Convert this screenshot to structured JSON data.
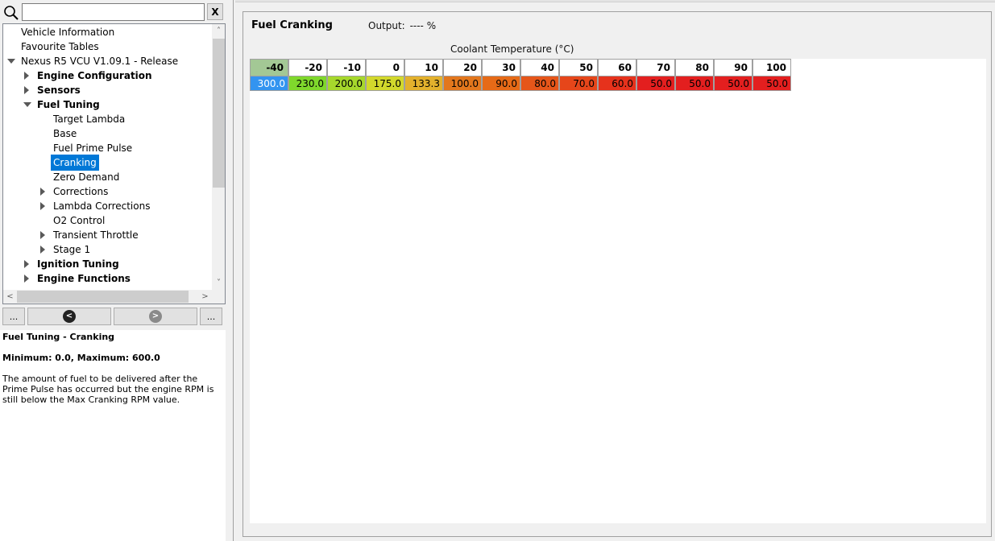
{
  "search": {
    "placeholder": "",
    "value": "",
    "clear_label": "X"
  },
  "tree": {
    "items": [
      {
        "label": "Vehicle Information",
        "level": 0,
        "arrow": "none",
        "bold": false,
        "selected": false
      },
      {
        "label": "Favourite Tables",
        "level": 0,
        "arrow": "none",
        "bold": false,
        "selected": false
      },
      {
        "label": "Nexus R5 VCU V1.09.1 - Release",
        "level": 0,
        "arrow": "down",
        "bold": false,
        "selected": false
      },
      {
        "label": "Engine Configuration",
        "level": 1,
        "arrow": "right",
        "bold": true,
        "selected": false
      },
      {
        "label": "Sensors",
        "level": 1,
        "arrow": "right",
        "bold": true,
        "selected": false
      },
      {
        "label": "Fuel Tuning",
        "level": 1,
        "arrow": "down",
        "bold": true,
        "selected": false
      },
      {
        "label": "Target Lambda",
        "level": 2,
        "arrow": "none",
        "bold": false,
        "selected": false
      },
      {
        "label": "Base",
        "level": 2,
        "arrow": "none",
        "bold": false,
        "selected": false
      },
      {
        "label": "Fuel Prime Pulse",
        "level": 2,
        "arrow": "none",
        "bold": false,
        "selected": false
      },
      {
        "label": "Cranking",
        "level": 2,
        "arrow": "none",
        "bold": false,
        "selected": true
      },
      {
        "label": "Zero Demand",
        "level": 2,
        "arrow": "none",
        "bold": false,
        "selected": false
      },
      {
        "label": "Corrections",
        "level": 2,
        "arrow": "right",
        "bold": false,
        "selected": false
      },
      {
        "label": "Lambda Corrections",
        "level": 2,
        "arrow": "right",
        "bold": false,
        "selected": false
      },
      {
        "label": "O2 Control",
        "level": 2,
        "arrow": "none",
        "bold": false,
        "selected": false
      },
      {
        "label": "Transient Throttle",
        "level": 2,
        "arrow": "right",
        "bold": false,
        "selected": false
      },
      {
        "label": "Stage 1",
        "level": 2,
        "arrow": "right",
        "bold": false,
        "selected": false
      },
      {
        "label": "Ignition Tuning",
        "level": 1,
        "arrow": "right",
        "bold": true,
        "selected": false
      },
      {
        "label": "Engine Functions",
        "level": 1,
        "arrow": "right",
        "bold": true,
        "selected": false
      }
    ]
  },
  "nav": {
    "more_left": "...",
    "more_right": "..."
  },
  "help": {
    "title": "Fuel Tuning - Cranking",
    "range": "Minimum: 0.0, Maximum: 600.0",
    "description": "The amount of fuel to be delivered after the Prime Pulse has occurred but the engine RPM is still below the Max Cranking RPM value."
  },
  "table": {
    "title": "Fuel Cranking",
    "output_label": "Output:",
    "output_value": "---- %",
    "axis_title": "Coolant Temperature (°C)",
    "headers": [
      "-40",
      "-20",
      "-10",
      "0",
      "10",
      "20",
      "30",
      "40",
      "50",
      "60",
      "70",
      "80",
      "90",
      "100"
    ],
    "values": [
      "300.0",
      "230.0",
      "200.0",
      "175.0",
      "133.3",
      "100.0",
      "90.0",
      "80.0",
      "70.0",
      "60.0",
      "50.0",
      "50.0",
      "50.0",
      "50.0"
    ],
    "value_colors": [
      "#3394f0",
      "#7fd82c",
      "#a6d82c",
      "#d2d82c",
      "#e3b12d",
      "#e3771d",
      "#e66a17",
      "#e6561a",
      "#e6461a",
      "#e6321c",
      "#e31f1f",
      "#e31f1f",
      "#e31f1f",
      "#e31f1f"
    ],
    "highlight_header_color": "#a3c895",
    "selected_value_text_color": "#ffffff"
  }
}
